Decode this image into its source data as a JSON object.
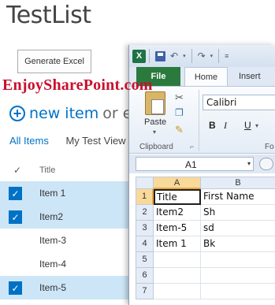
{
  "sharepoint": {
    "page_title": "TestList",
    "generate_button_label": "Generate Excel",
    "watermark": "EnjoySharePoint.com",
    "new_item_plus": "+",
    "new_item_label": "new item",
    "new_item_suffix": "or ed",
    "views": [
      {
        "label": "All Items",
        "active": true
      },
      {
        "label": "My Test View",
        "active": false
      }
    ],
    "column_check_glyph": "✓",
    "column_title": "Title",
    "rows": [
      {
        "label": "Item 1",
        "selected": true
      },
      {
        "label": "Item2",
        "selected": true
      },
      {
        "label": "Item-3",
        "selected": false
      },
      {
        "label": "Item-4",
        "selected": false
      },
      {
        "label": "Item-5",
        "selected": true
      }
    ]
  },
  "excel": {
    "app_icon_letter": "X",
    "tabs": {
      "file": "File",
      "home": "Home",
      "insert": "Insert"
    },
    "clipboard": {
      "paste_label": "Paste",
      "paste_arrow": "▾",
      "group_label": "Clipboard",
      "launcher": "⌐"
    },
    "font": {
      "name": "Calibri",
      "bold": "B",
      "italic": "I",
      "underline": "U",
      "underline_drop": "▾",
      "group_label_partial": "Fo"
    },
    "name_box": {
      "value": "A1",
      "arrow": "▾"
    },
    "columns": [
      "A",
      "B"
    ],
    "rows": [
      "1",
      "2",
      "3",
      "4",
      "5",
      "6",
      "7"
    ],
    "cells": [
      [
        "Title",
        "First Name"
      ],
      [
        "Item2",
        "Sh"
      ],
      [
        "Item-5",
        "sd"
      ],
      [
        "Item 1",
        "Bk"
      ],
      [
        "",
        ""
      ],
      [
        "",
        ""
      ],
      [
        "",
        ""
      ]
    ],
    "colors": {
      "file_tab": "#2a7a3e",
      "active_header": "#f9d99a",
      "accent": "#0072c6"
    }
  }
}
